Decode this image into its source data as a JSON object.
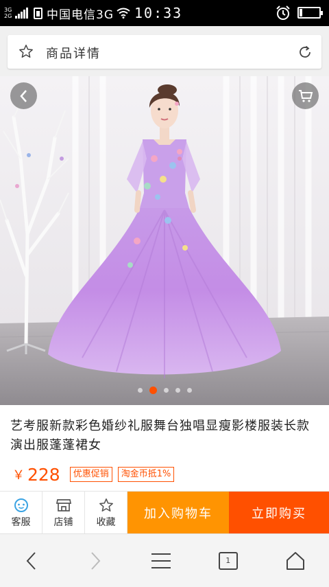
{
  "status_bar": {
    "network_top": "3G",
    "network_bottom": "2G",
    "carrier": "中国电信3G",
    "time": "10:33",
    "battery_level": 0.15
  },
  "header": {
    "title": "商品详情"
  },
  "gallery": {
    "image_count": 5,
    "active_index": 1
  },
  "product": {
    "title": "艺考服新款彩色婚纱礼服舞台独唱显瘦影楼服装长款演出服蓬蓬裙女",
    "currency": "￥",
    "price": "228",
    "tags": [
      "优惠促销",
      "淘金币抵1%"
    ]
  },
  "actions": {
    "service_label": "客服",
    "store_label": "店铺",
    "favorite_label": "收藏",
    "add_to_cart_label": "加入购物车",
    "buy_now_label": "立即购买"
  },
  "browser_nav": {
    "tab_count": "1"
  },
  "colors": {
    "accent_orange": "#ff5000",
    "cart_orange": "#ff9402",
    "service_blue": "#3aa3e3"
  }
}
